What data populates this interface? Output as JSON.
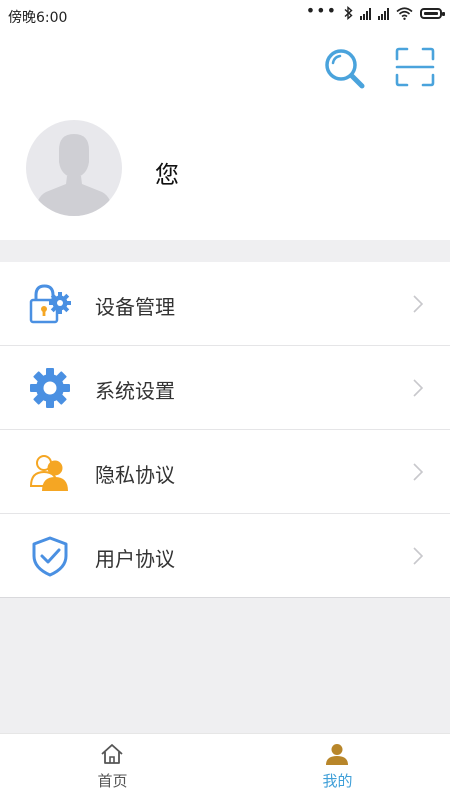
{
  "status_bar": {
    "time": "傍晚6:00",
    "dots": "•••"
  },
  "header": {
    "username": "您"
  },
  "menu": [
    {
      "label": "设备管理",
      "icon": "lock-gear-icon"
    },
    {
      "label": "系统设置",
      "icon": "gear-icon"
    },
    {
      "label": "隐私协议",
      "icon": "users-icon"
    },
    {
      "label": "用户协议",
      "icon": "shield-check-icon"
    }
  ],
  "tabbar": {
    "items": [
      {
        "label": "首页",
        "icon": "home-icon",
        "active": false
      },
      {
        "label": "我的",
        "icon": "person-icon",
        "active": true
      }
    ]
  },
  "colors": {
    "accent": "#3f9fd8",
    "icon_blue": "#4a90e2",
    "icon_orange": "#f5a623",
    "page_bg": "#efeff1"
  }
}
